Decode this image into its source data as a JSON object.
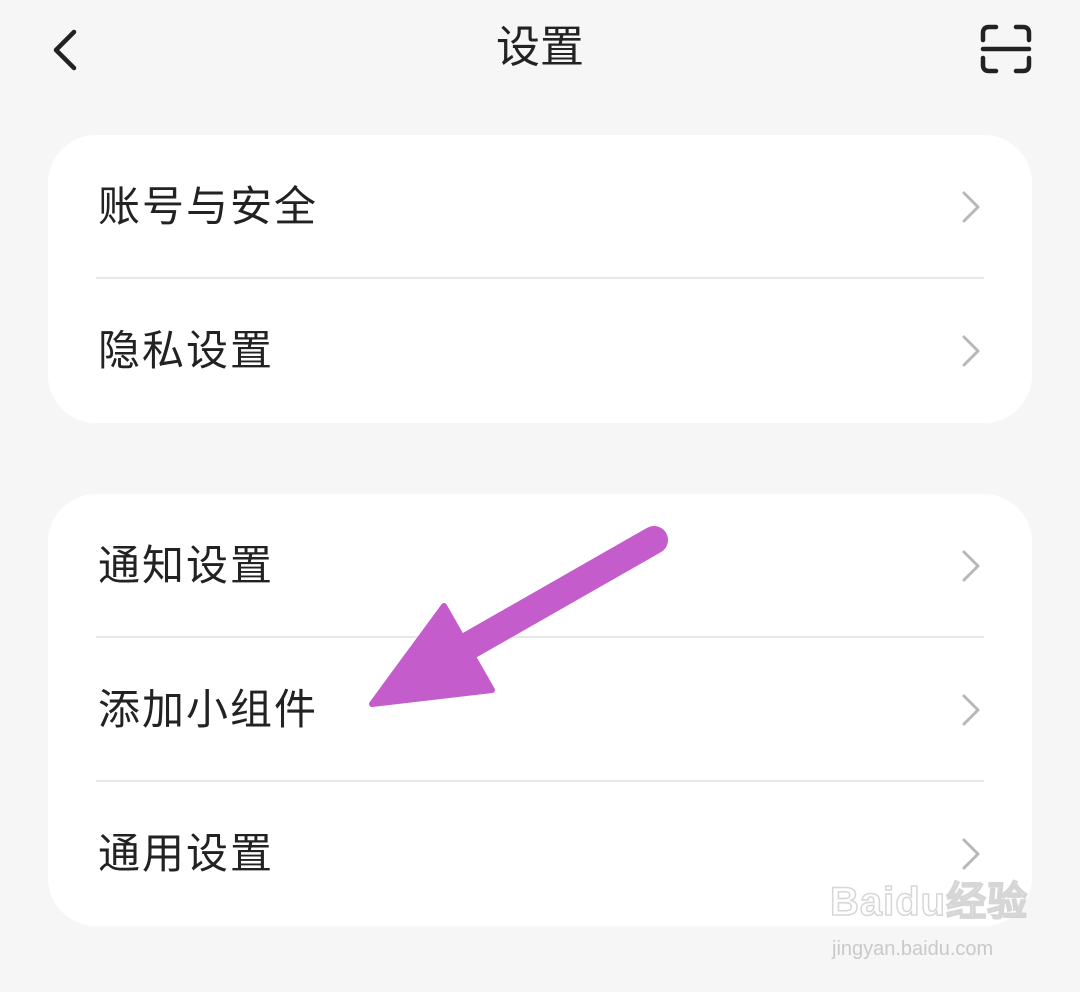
{
  "header": {
    "title": "设置",
    "back_icon": "chevron-left-icon",
    "scan_icon": "scan-icon"
  },
  "groups": [
    {
      "items": [
        {
          "label": "账号与安全",
          "icon": "chevron-right-icon"
        },
        {
          "label": "隐私设置",
          "icon": "chevron-right-icon"
        }
      ]
    },
    {
      "items": [
        {
          "label": "通知设置",
          "icon": "chevron-right-icon"
        },
        {
          "label": "添加小组件",
          "icon": "chevron-right-icon"
        },
        {
          "label": "通用设置",
          "icon": "chevron-right-icon"
        }
      ]
    }
  ],
  "annotation": {
    "type": "arrow",
    "color": "#c45ccc",
    "points_to": "添加小组件"
  },
  "watermark": {
    "logo": "Baidu经验",
    "url": "jingyan.baidu.com"
  },
  "colors": {
    "background": "#f6f6f6",
    "card": "#ffffff",
    "text": "#222222",
    "divider": "#e7e7e7",
    "chevron": "#b8b8b8"
  }
}
